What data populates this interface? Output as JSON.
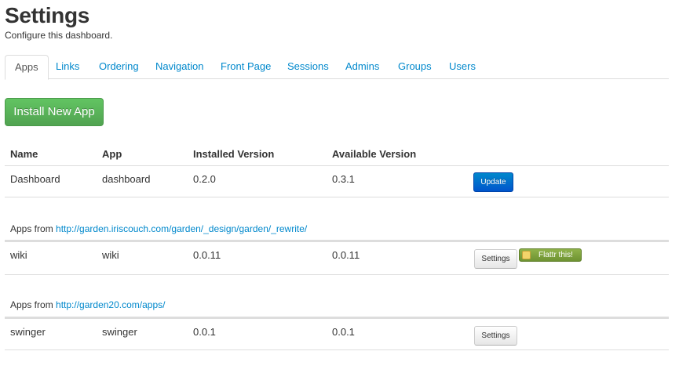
{
  "header": {
    "title": "Settings",
    "subtitle": "Configure this dashboard."
  },
  "tabs": [
    {
      "label": "Apps",
      "active": true
    },
    {
      "label": "Links",
      "active": false
    },
    {
      "label": "Ordering",
      "active": false
    },
    {
      "label": "Navigation",
      "active": false
    },
    {
      "label": "Front Page",
      "active": false
    },
    {
      "label": "Sessions",
      "active": false
    },
    {
      "label": "Admins",
      "active": false
    },
    {
      "label": "Groups",
      "active": false
    },
    {
      "label": "Users",
      "active": false
    }
  ],
  "install_button": "Install New App",
  "table": {
    "headers": [
      "Name",
      "App",
      "Installed Version",
      "Available Version"
    ],
    "main_rows": [
      {
        "name": "Dashboard",
        "app": "dashboard",
        "installed": "0.2.0",
        "available": "0.3.1",
        "action": "Update"
      }
    ]
  },
  "sources": [
    {
      "prefix": "Apps from",
      "url": "http://garden.iriscouch.com/garden/_design/garden/_rewrite/",
      "rows": [
        {
          "name": "wiki",
          "app": "wiki",
          "installed": "0.0.11",
          "available": "0.0.11",
          "action": "Settings",
          "flattr": "Flattr this!"
        }
      ]
    },
    {
      "prefix": "Apps from",
      "url": "http://garden20.com/apps/",
      "rows": [
        {
          "name": "swinger",
          "app": "swinger",
          "installed": "0.0.1",
          "available": "0.0.1",
          "action": "Settings"
        }
      ]
    }
  ],
  "colors": {
    "link": "#0088cc",
    "install_green": "#5bb75b",
    "update_blue": "#0074cc",
    "flattr_green": "#7ea23e"
  }
}
